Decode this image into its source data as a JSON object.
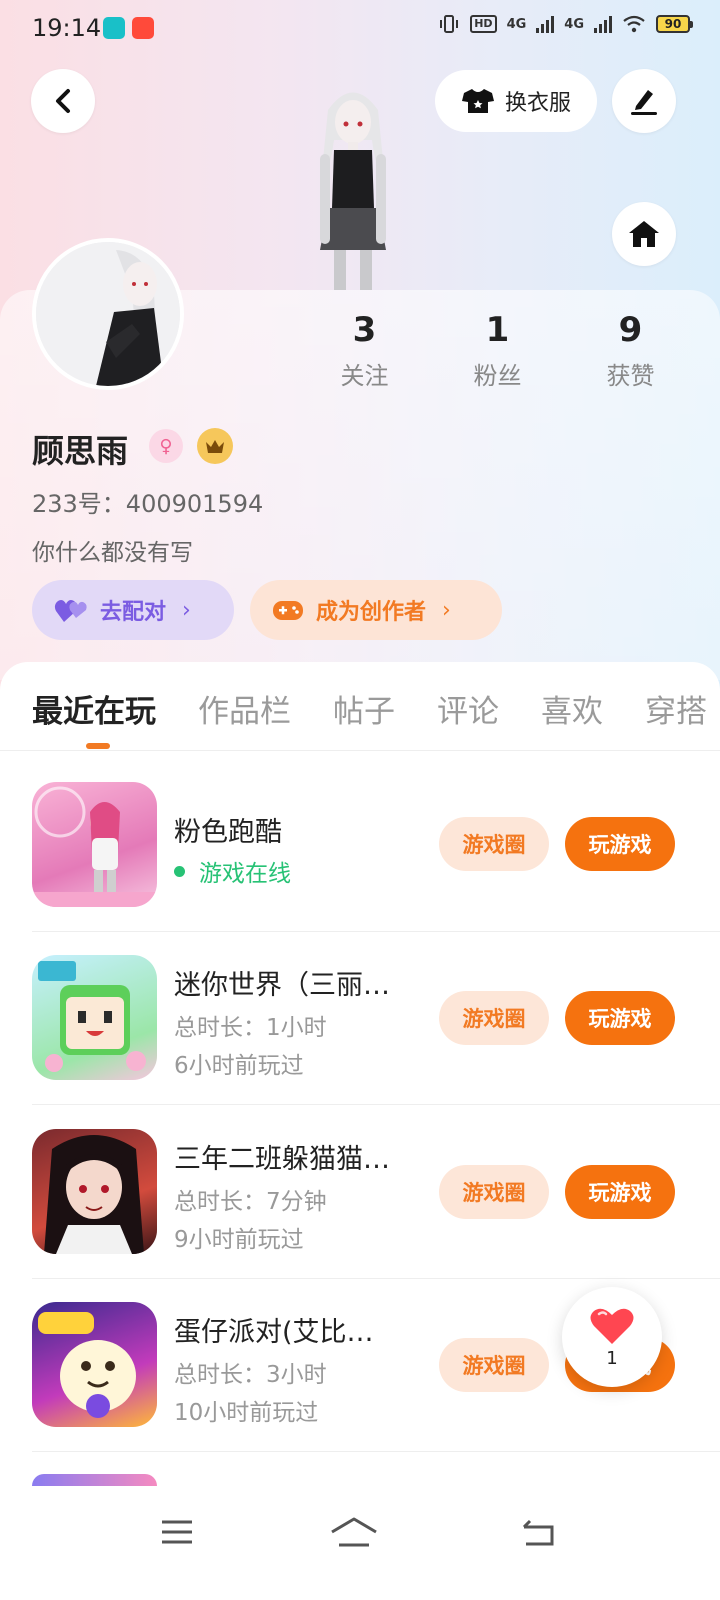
{
  "status_bar": {
    "time": "19:14",
    "network_1": "4G",
    "network_2": "4G",
    "hd_label": "HD",
    "battery": "90"
  },
  "header": {
    "dress_button_label": "换衣服"
  },
  "profile": {
    "username": "顾思雨",
    "user_id": "233号：400901594",
    "bio": "你什么都没有写",
    "stats": [
      {
        "value": "3",
        "label": "关注"
      },
      {
        "value": "1",
        "label": "粉丝"
      },
      {
        "value": "9",
        "label": "获赞"
      }
    ],
    "match_button": "去配对",
    "creator_button": "成为创作者"
  },
  "tabs": [
    {
      "label": "最近在玩",
      "active": true
    },
    {
      "label": "作品栏",
      "active": false
    },
    {
      "label": "帖子",
      "active": false
    },
    {
      "label": "评论",
      "active": false
    },
    {
      "label": "喜欢",
      "active": false
    },
    {
      "label": "穿搭",
      "active": false
    }
  ],
  "games": [
    {
      "title": "粉色跑酷",
      "status": "游戏在线",
      "circle_label": "游戏圈",
      "play_label": "玩游戏"
    },
    {
      "title": "迷你世界（三丽…",
      "duration": "总时长：1小时",
      "last_played": "6小时前玩过",
      "circle_label": "游戏圈",
      "play_label": "玩游戏"
    },
    {
      "title": "三年二班躲猫猫…",
      "duration": "总时长：7分钟",
      "last_played": "9小时前玩过",
      "circle_label": "游戏圈",
      "play_label": "玩游戏"
    },
    {
      "title": "蛋仔派对(艾比…",
      "duration": "总时长：3小时",
      "last_played": "10小时前玩过",
      "circle_label": "游戏圈",
      "play_label": "玩游戏"
    }
  ],
  "floating_like": {
    "count": "1"
  },
  "colors": {
    "accent": "#f5720f",
    "online": "#27c275",
    "match": "#7b5ce2"
  }
}
